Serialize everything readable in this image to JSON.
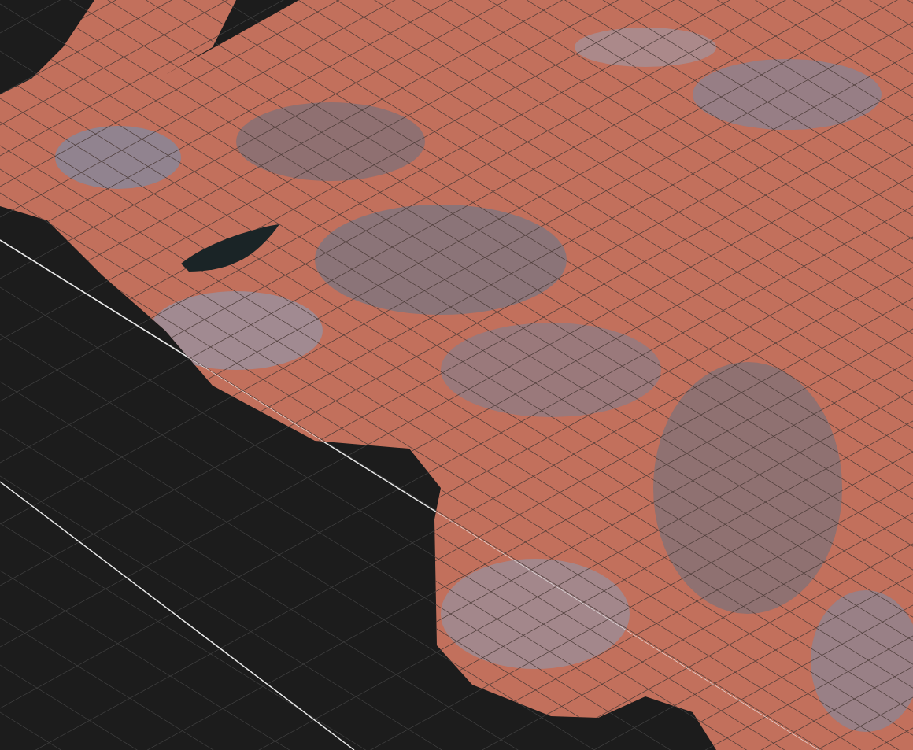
{
  "viewport": {
    "grid_visible": true
  }
}
